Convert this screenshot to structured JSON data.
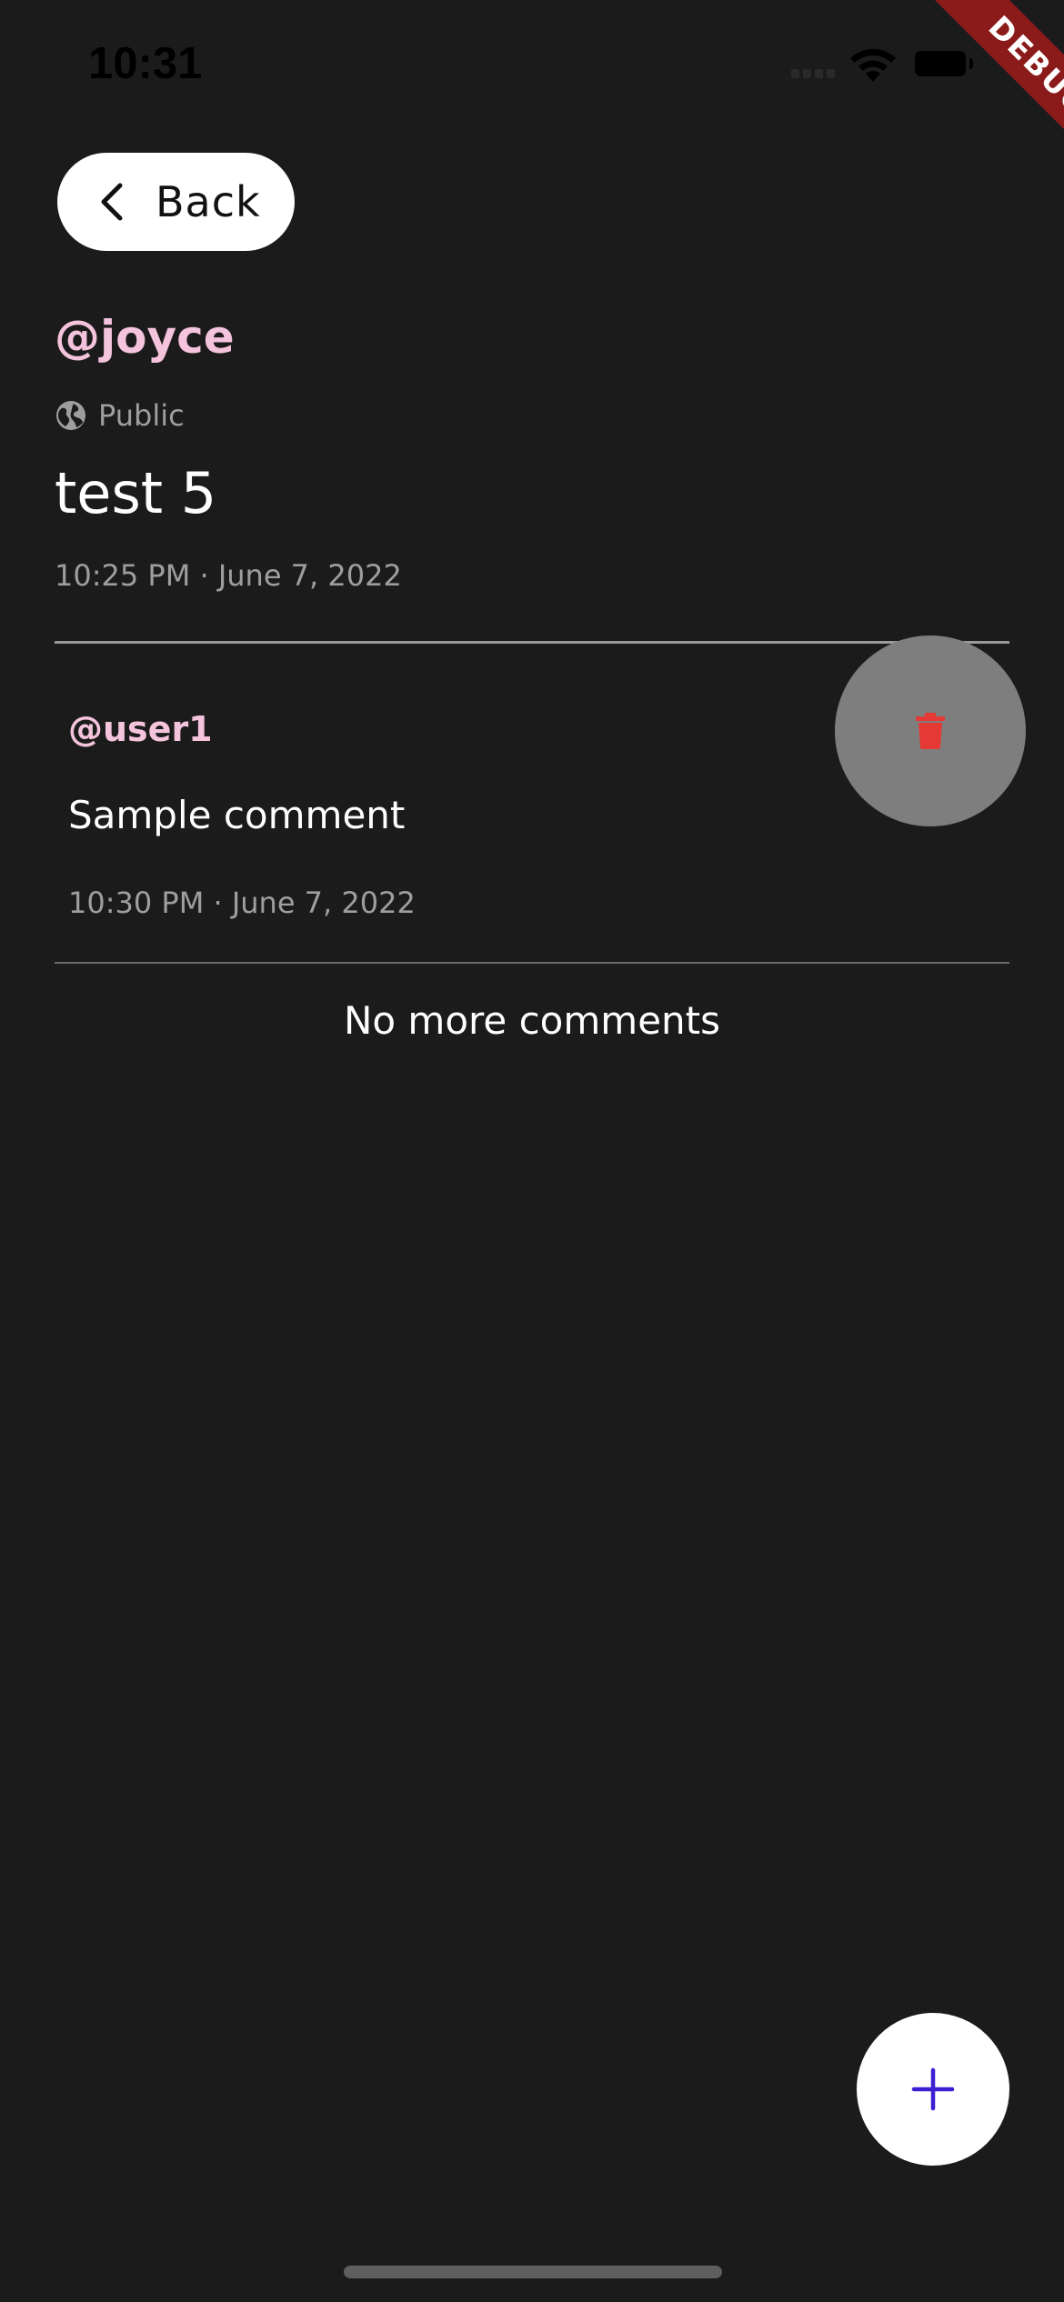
{
  "status_bar": {
    "time": "10:31"
  },
  "debug_banner": {
    "label": "DEBUG"
  },
  "nav": {
    "back_label": "Back"
  },
  "post": {
    "username": "@joyce",
    "visibility": "Public",
    "title": "test 5",
    "timestamp": "10:25 PM · June 7, 2022"
  },
  "comments": [
    {
      "username": "@user1",
      "text": "Sample comment",
      "timestamp": "10:30 PM · June 7, 2022"
    }
  ],
  "end_of_list": "No more comments",
  "icons": {
    "back": "chevron-left-icon",
    "visibility": "globe-icon",
    "delete": "trash-icon",
    "add": "plus-icon"
  },
  "colors": {
    "background": "#1c1b1c",
    "username": "#f4c3dc",
    "delete_icon": "#e53935",
    "delete_bg": "#7e7e7e",
    "fab_icon": "#3a1fd1",
    "debug_banner": "#8b1a1a"
  }
}
